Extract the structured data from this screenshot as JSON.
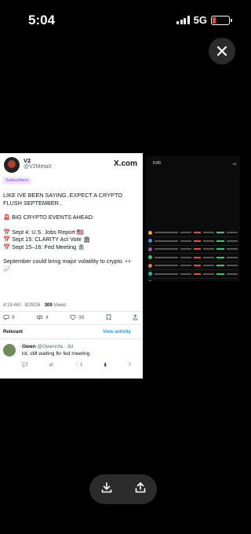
{
  "status_bar": {
    "time": "5:04",
    "network": "5G",
    "battery_level_percent": 20,
    "battery_color": "#e74c3c"
  },
  "tweet": {
    "author_name": "V2",
    "author_handle": "@V2MetaX",
    "brand": "X.com",
    "subscribers_label": "Subscribers",
    "body": [
      "LIKE IVE BEEN SAYING..EXPECT A CRYPTO FLUSH SEPTEMBER..",
      "🚨 BIG CRYPTO EVENTS AHEAD:",
      "📅 Sept 4: U.S. Jobs Report 🇺🇸\n📅 Sept 15: CLARITY Act Vote 🏛\n📅 Sept 15–16: Fed Meeting 🏦",
      "September could bring major volatility to crypto. 👀📈"
    ],
    "timestamp": "4:19 AM · 8/29/26 · ",
    "views_count": "309",
    "views_label": " Views",
    "replies": "9",
    "retweets": "4",
    "likes": "39",
    "relevant_label": "Relevant",
    "view_activity_label": "View activity"
  },
  "reply": {
    "name": "Owen",
    "handle": "@Owennfa · 3d",
    "text": "lol, still waiting fkr fed meeting",
    "likes": "1"
  },
  "preview": {
    "time": "5:00",
    "status": "5G",
    "row_count": 8
  },
  "icons": {
    "close": "close-icon",
    "download": "download-icon",
    "share": "share-icon"
  }
}
